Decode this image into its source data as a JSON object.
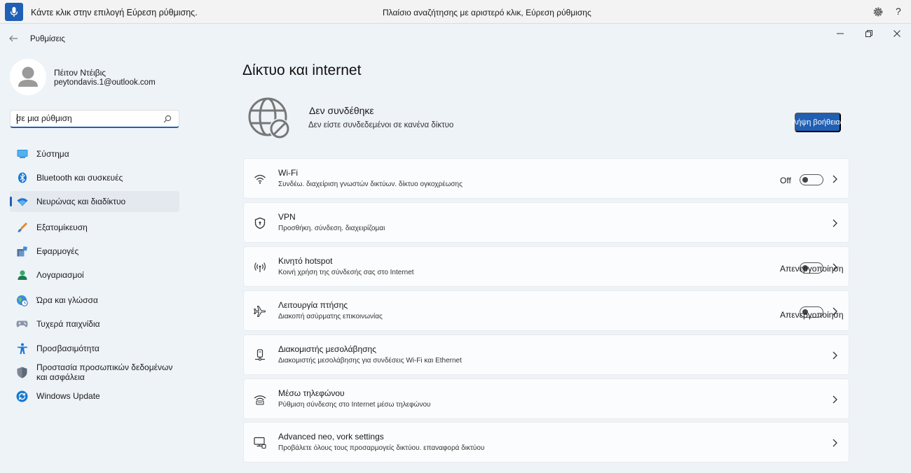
{
  "voice_bar": {
    "prompt": "Κάντε κλικ στην επιλογή Εύρεση ρύθμισης.",
    "status": "Πλαίσιο αναζήτησης με αριστερό κλικ, Εύρεση ρύθμισης",
    "help": "?"
  },
  "window": {
    "title": "Ρυθμίσεις"
  },
  "profile": {
    "name": "Πέιτον Ντέιβις",
    "email": "peytondavis.1@outlook.com"
  },
  "search": {
    "value": "σε μια ρύθμιση"
  },
  "nav": {
    "items": [
      {
        "label": "Σύστημα",
        "icon": "system-icon"
      },
      {
        "label": "Bluetooth και συσκευές",
        "icon": "bluetooth-icon"
      },
      {
        "label": "Νευρώνας και διαδίκτυο",
        "icon": "wifi-icon"
      },
      {
        "label": "Εξατομίκευση",
        "icon": "brush-icon"
      },
      {
        "label": "Εφαρμογές",
        "icon": "apps-icon"
      },
      {
        "label": "Λογαριασμοί",
        "icon": "account-icon"
      },
      {
        "label": "Ώρα και γλώσσα",
        "icon": "globe-clock-icon"
      },
      {
        "label": "Τυχερά παιχνίδια",
        "icon": "gamepad-icon"
      },
      {
        "label": "Προσβασιμότητα",
        "icon": "accessibility-icon"
      },
      {
        "label": "Προστασία προσωπικών δεδομένων και ασφάλεια",
        "icon": "shield-icon"
      },
      {
        "label": "Windows Update",
        "icon": "update-icon"
      }
    ],
    "active": "Νευρώνας και διαδίκτυο"
  },
  "main": {
    "title": "Δίκτυο και internet",
    "status": {
      "title": "Δεν συνδέθηκε",
      "subtitle": "Δεν είστε συνδεδεμένοι σε κανένα δίκτυο",
      "help_button": "Λήψη βοήθειας"
    },
    "cards": [
      {
        "title": "Wi-Fi",
        "subtitle": "Συνδέω. διαχείριση γνωστών δικτύων. δίκτυο ογκοχρέωσης",
        "toggle_label": "Off",
        "icon": "wifi-icon"
      },
      {
        "title": "VPN",
        "subtitle": "Προσθήκη. σύνδεση. διαχειρίζομαι",
        "icon": "vpn-shield-icon"
      },
      {
        "title": "Κινητό hotspot",
        "subtitle": "Κοινή χρήση της σύνδεσής σας στο Internet",
        "toggle_label": "Απενεργοποίηση",
        "icon": "hotspot-icon"
      },
      {
        "title": "Λειτουργία πτήσης",
        "subtitle": "Διακοπή ασύρματης επικοινωνίας",
        "toggle_label": "Απενεργοποίηση",
        "icon": "airplane-icon"
      },
      {
        "title": "Διακομιστής μεσολάβησης",
        "subtitle": "Διακομιστής μεσολάβησης για συνδέσεις Wi-Fi και Ethernet",
        "icon": "proxy-icon"
      },
      {
        "title": "Μέσω τηλεφώνου",
        "subtitle": "Ρύθμιση σύνδεσης στο Internet μέσω τηλεφώνου",
        "icon": "dialup-icon"
      },
      {
        "title": "Advanced neo, vork settings",
        "subtitle": "Προβάλετε όλους τους προσαρμογείς δικτύου. επαναφορά δικτύου",
        "icon": "monitor-network-icon"
      }
    ]
  },
  "colors": {
    "accent": "#1f5fb5",
    "background": "#eef3f8",
    "card": "#fbfcfd"
  }
}
